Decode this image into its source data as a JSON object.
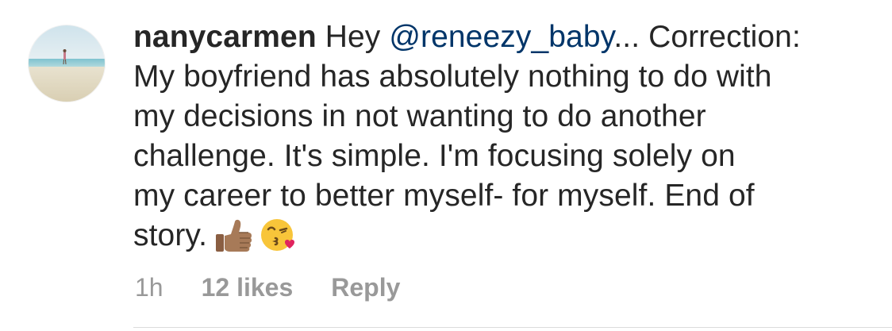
{
  "comment": {
    "username": "nanycarmen",
    "text_lines": [
      {
        "before": " Hey ",
        "mention": "@reneezy_baby",
        "after": "... Correction:"
      },
      "My boyfriend has absolutely nothing to do with",
      "my decisions in not wanting to do another",
      "challenge. It's simple. I'm focusing solely on",
      "my career to better myself- for myself. End of",
      "story."
    ],
    "emojis": [
      "thumbs-up-medium-skin",
      "face-blowing-a-kiss"
    ],
    "time": "1h",
    "likes": "12 likes",
    "reply_label": "Reply"
  },
  "colors": {
    "text": "#262626",
    "mention": "#003569",
    "meta": "#999999"
  }
}
